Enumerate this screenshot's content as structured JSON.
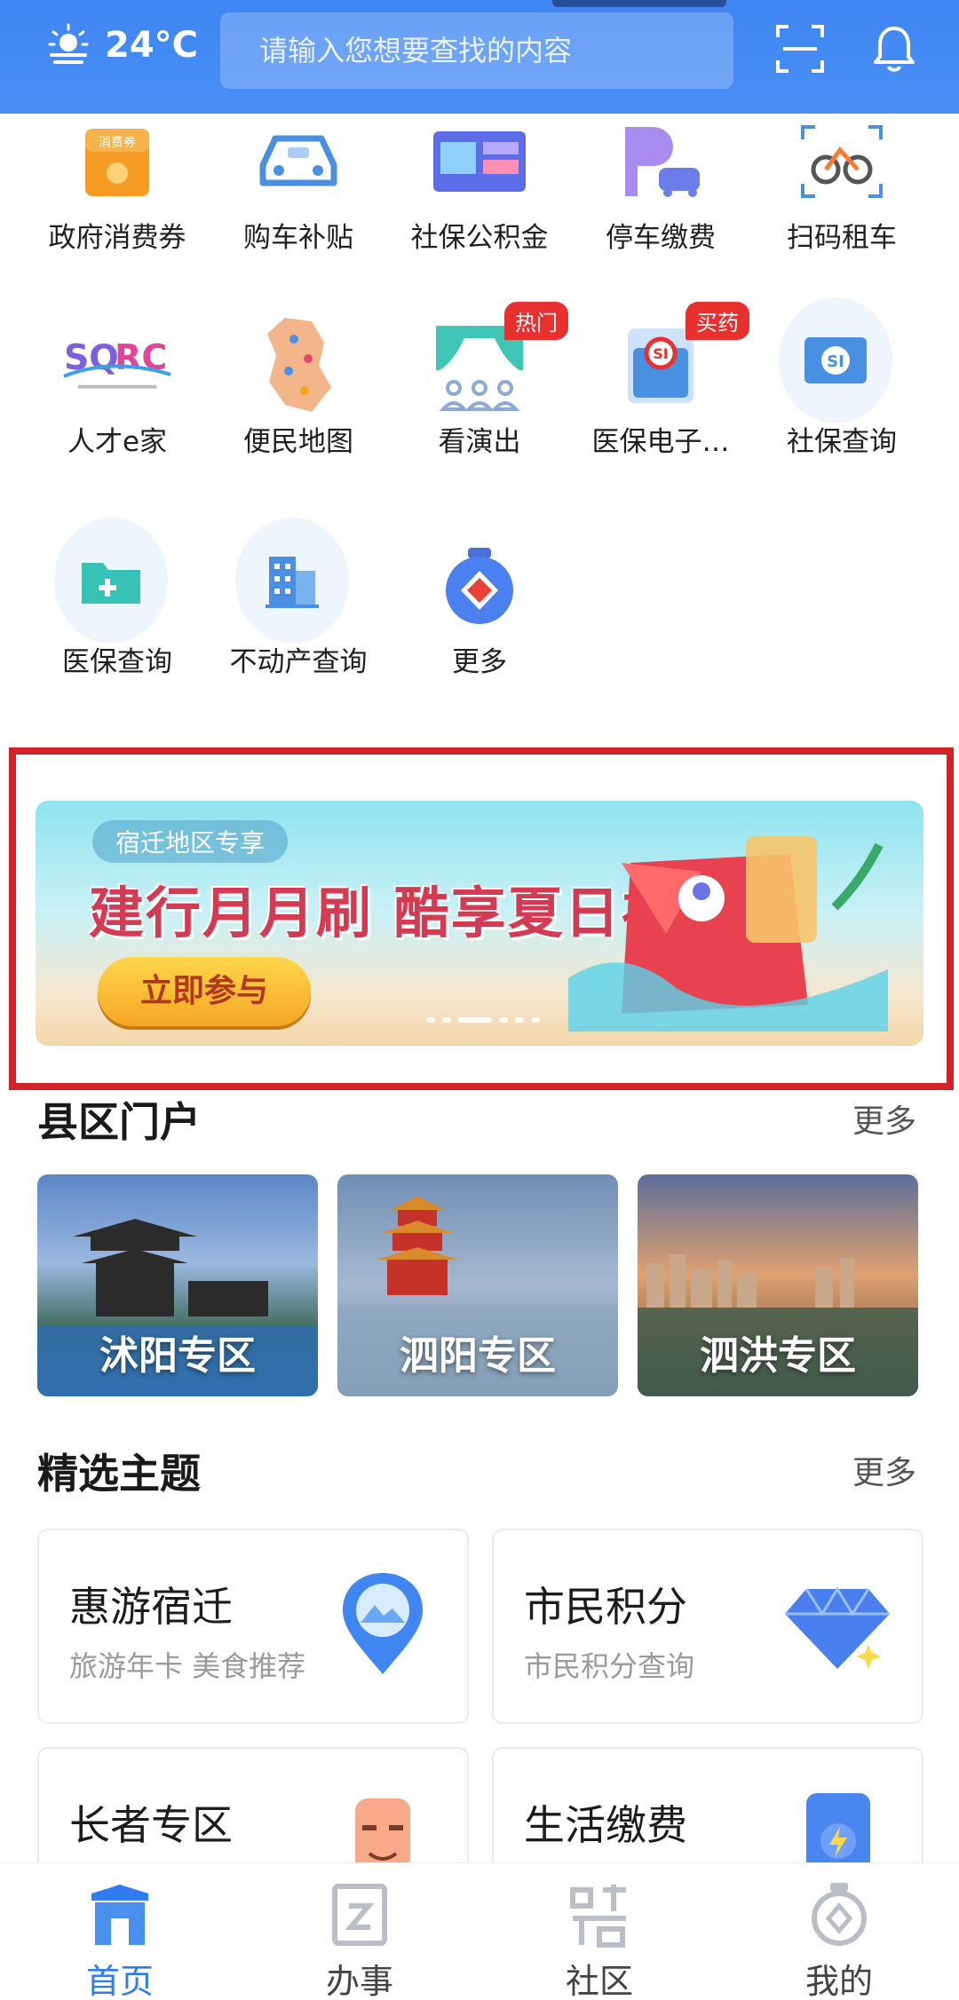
{
  "header": {
    "temperature": "24°C",
    "search_placeholder": "请输入您想要查找的内容"
  },
  "services": [
    {
      "label": "政府消费券",
      "icon": "coupon-icon",
      "badge": ""
    },
    {
      "label": "购车补贴",
      "icon": "car-icon",
      "badge": ""
    },
    {
      "label": "社保公积金",
      "icon": "social-fund-icon",
      "badge": ""
    },
    {
      "label": "停车缴费",
      "icon": "parking-icon",
      "badge": ""
    },
    {
      "label": "扫码租车",
      "icon": "bike-icon",
      "badge": ""
    },
    {
      "label": "人才e家",
      "icon": "talent-logo-icon",
      "badge": ""
    },
    {
      "label": "便民地图",
      "icon": "map-icon",
      "badge": ""
    },
    {
      "label": "看演出",
      "icon": "theater-icon",
      "badge": "热门"
    },
    {
      "label": "医保电子…",
      "icon": "medical-card-icon",
      "badge": "买药"
    },
    {
      "label": "社保查询",
      "icon": "social-security-icon",
      "badge": ""
    },
    {
      "label": "医保查询",
      "icon": "medical-folder-icon",
      "badge": ""
    },
    {
      "label": "不动产查询",
      "icon": "building-icon",
      "badge": ""
    },
    {
      "label": "更多",
      "icon": "more-icon",
      "badge": ""
    }
  ],
  "banner": {
    "tag": "宿迁地区专享",
    "headline": "建行月月刷 酷享夏日礼",
    "cta": "立即参与"
  },
  "county": {
    "title": "县区门户",
    "more": "更多",
    "items": [
      {
        "name": "沭阳专区"
      },
      {
        "name": "泗阳专区"
      },
      {
        "name": "泗洪专区"
      }
    ]
  },
  "themes": {
    "title": "精选主题",
    "more": "更多",
    "items": [
      {
        "title": "惠游宿迁",
        "subtitle": "旅游年卡 美食推荐",
        "icon": "location-pin-icon"
      },
      {
        "title": "市民积分",
        "subtitle": "市民积分查询",
        "icon": "diamond-icon"
      },
      {
        "title": "长者专区",
        "subtitle": "",
        "icon": "elder-face-icon"
      },
      {
        "title": "生活缴费",
        "subtitle": "",
        "icon": "phone-bill-icon"
      }
    ]
  },
  "nav": [
    {
      "label": "首页",
      "icon": "home-icon",
      "active": true
    },
    {
      "label": "办事",
      "icon": "service-icon",
      "active": false
    },
    {
      "label": "社区",
      "icon": "community-icon",
      "active": false
    },
    {
      "label": "我的",
      "icon": "profile-icon",
      "active": false
    }
  ]
}
